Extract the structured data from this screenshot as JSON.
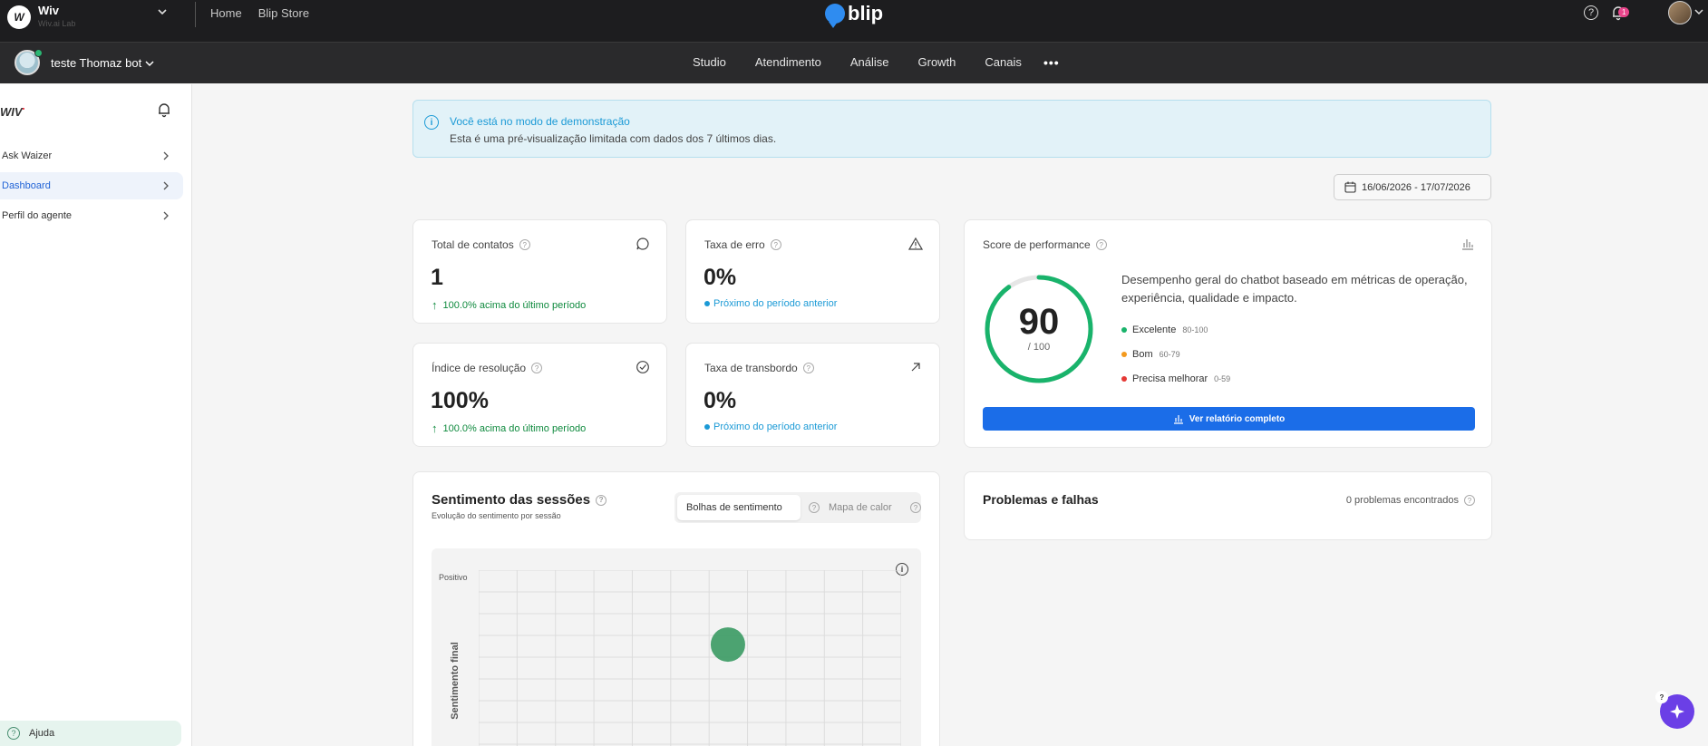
{
  "topbar": {
    "org_name": "Wiv",
    "org_subtitle": "Wiv.ai Lab",
    "org_logo_letter": "W",
    "links": [
      "Home",
      "Blip Store"
    ],
    "brand": "blip",
    "notification_count": "1"
  },
  "subbar": {
    "bot_name": "teste Thomaz bot",
    "nav": [
      "Studio",
      "Atendimento",
      "Análise",
      "Growth",
      "Canais"
    ],
    "more": "•••",
    "icons": [
      "puzzle-icon",
      "gear-icon",
      "team-icon",
      "flask-icon"
    ]
  },
  "sidebar": {
    "logo": "WIV",
    "items": [
      {
        "label": "Ask Waizer",
        "active": false
      },
      {
        "label": "Dashboard",
        "active": true
      },
      {
        "label": "Perfil do agente",
        "active": false
      }
    ],
    "help_label": "Ajuda"
  },
  "banner": {
    "title": "Você está no modo de demonstração",
    "text": "Esta é uma pré-visualização limitada com dados dos 7 últimos dias."
  },
  "date_range": "16/06/2026 - 17/07/2026",
  "metrics": [
    {
      "title": "Total de contatos",
      "value": "1",
      "note": "100.0% acima do último período",
      "trend": "up",
      "icon": "chat-bubble-icon"
    },
    {
      "title": "Taxa de erro",
      "value": "0%",
      "note": "Próximo do período anterior",
      "trend": "neutral",
      "icon": "warning-icon"
    },
    {
      "title": "Índice de resolução",
      "value": "100%",
      "note": "100.0% acima do último período",
      "trend": "up",
      "icon": "check-circle-icon"
    },
    {
      "title": "Taxa de transbordo",
      "value": "0%",
      "note": "Próximo do período anterior",
      "trend": "neutral",
      "icon": "arrow-up-right-icon"
    }
  ],
  "performance": {
    "title": "Score de performance",
    "score": 90,
    "score_label": "90",
    "max_label": "/ 100",
    "description": "Desempenho geral do chatbot baseado em métricas de operação, experiência, qualidade e impacto.",
    "legend": [
      {
        "label": "Excelente",
        "range": "80-100",
        "color": "#19b36b"
      },
      {
        "label": "Bom",
        "range": "60-79",
        "color": "#f39a1e"
      },
      {
        "label": "Precisa melhorar",
        "range": "0-59",
        "color": "#e53935"
      }
    ],
    "button_label": "Ver relatório completo"
  },
  "sentiment": {
    "title": "Sentimento das sessões",
    "subtitle": "Evolução do sentimento por sessão",
    "tabs": [
      "Bolhas de sentimento",
      "Mapa de calor"
    ],
    "active_tab": "Bolhas de sentimento",
    "y_tick": "Positivo",
    "y_label": "Sentimento final",
    "bubble_color": "#3a9a63"
  },
  "problems": {
    "title": "Problemas e falhas",
    "count": "0 problemas encontrados"
  },
  "colors": {
    "accent": "#1b6de8",
    "success": "#0f8a3e",
    "info": "#1b9ad6",
    "gauge": "#19b36b"
  }
}
